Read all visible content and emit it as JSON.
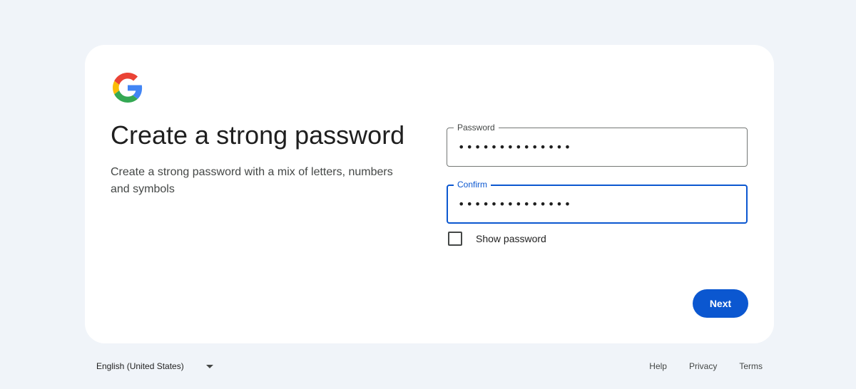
{
  "header": {
    "logo_icon": "google-g-logo"
  },
  "main": {
    "title": "Create a strong password",
    "subtitle": "Create a strong password with a mix of letters, numbers and symbols"
  },
  "form": {
    "password": {
      "label": "Password",
      "value": "••••••••••••••"
    },
    "confirm": {
      "label": "Confirm",
      "value": "••••••••••••••",
      "focused": true
    },
    "show_password": {
      "label": "Show password",
      "checked": false
    },
    "next_label": "Next"
  },
  "footer": {
    "language": "English (United States)",
    "links": [
      "Help",
      "Privacy",
      "Terms"
    ]
  },
  "colors": {
    "background": "#f0f4f9",
    "card": "#ffffff",
    "accent": "#0b57d0",
    "text": "#1f1f1f",
    "muted": "#444746",
    "google_blue": "#4285F4",
    "google_red": "#EA4335",
    "google_yellow": "#FBBC05",
    "google_green": "#34A853"
  }
}
